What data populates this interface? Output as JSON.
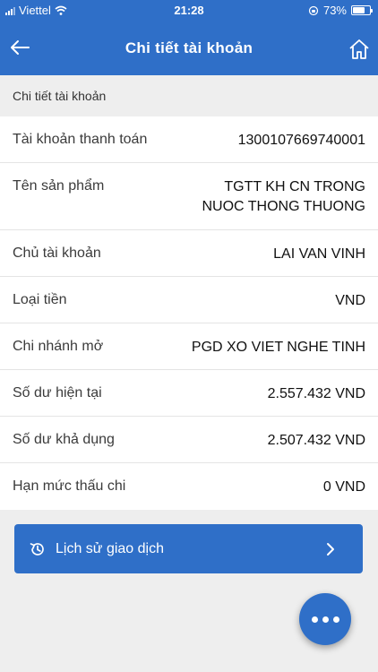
{
  "status_bar": {
    "carrier": "Viettel",
    "time": "21:28",
    "battery": "73%",
    "battery_level": 0.73
  },
  "header": {
    "title": "Chi tiết tài khoản",
    "back_icon": "arrow-left-icon",
    "home_icon": "home-icon"
  },
  "section": {
    "title": "Chi tiết tài khoản"
  },
  "details": [
    {
      "label": "Tài khoản thanh toán",
      "value": [
        "1300107669740001"
      ]
    },
    {
      "label": "Tên sản phẩm",
      "value": [
        "TGTT KH CN TRONG",
        "NUOC THONG THUONG"
      ]
    },
    {
      "label": "Chủ tài khoản",
      "value": [
        "LAI VAN VINH"
      ]
    },
    {
      "label": "Loại tiền",
      "value": [
        "VND"
      ]
    },
    {
      "label": "Chi nhánh mở",
      "value": [
        "PGD XO VIET NGHE TINH"
      ]
    },
    {
      "label": "Số dư hiện tại",
      "value": [
        "2.557.432 VND"
      ]
    },
    {
      "label": "Số dư khả dụng",
      "value": [
        "2.507.432 VND"
      ]
    },
    {
      "label": "Hạn mức thấu chi",
      "value": [
        "0 VND"
      ]
    }
  ],
  "history_button": {
    "label": "Lịch sử giao dịch",
    "icon": "history-icon"
  },
  "fab": {
    "icon": "more-horizontal-icon"
  },
  "colors": {
    "primary": "#2f6fc8",
    "background": "#eeeeee"
  }
}
